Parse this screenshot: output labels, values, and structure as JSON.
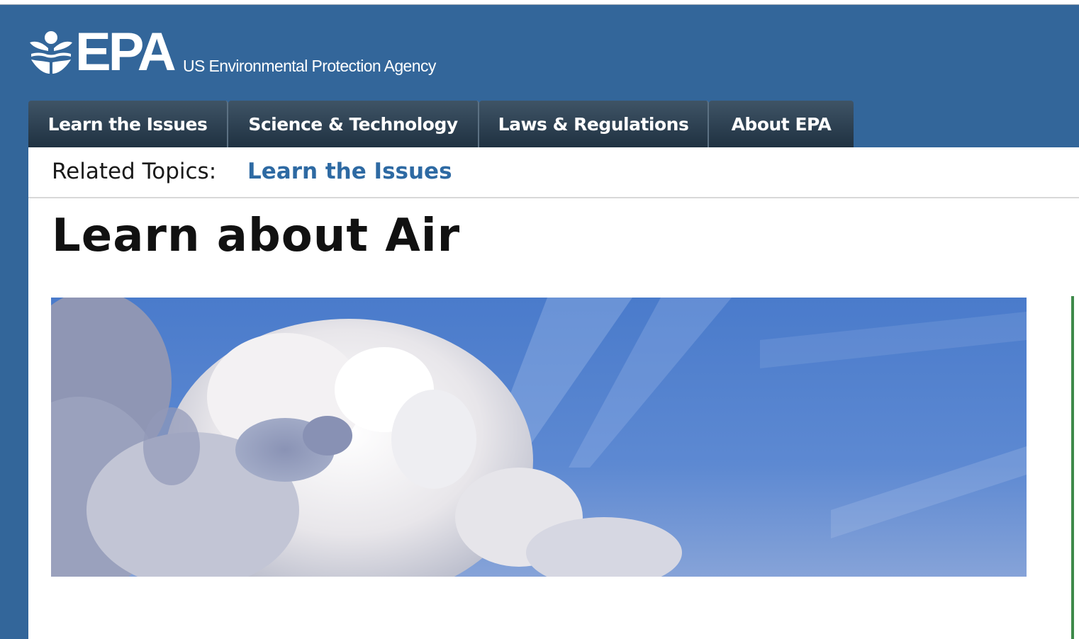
{
  "header": {
    "logo_text": "EPA",
    "agency_name": "US Environmental Protection Agency"
  },
  "nav": {
    "tabs": [
      {
        "label": "Learn the Issues"
      },
      {
        "label": "Science & Technology"
      },
      {
        "label": "Laws & Regulations"
      },
      {
        "label": "About EPA"
      }
    ]
  },
  "related": {
    "label": "Related Topics:",
    "link": "Learn the Issues"
  },
  "page": {
    "title": "Learn about Air"
  },
  "icons": {
    "logo": "epa-flower-logo-icon"
  },
  "colors": {
    "header_bg": "#33669a",
    "nav_tab_bg": "#2b3e50",
    "link": "#2e6aa3"
  }
}
